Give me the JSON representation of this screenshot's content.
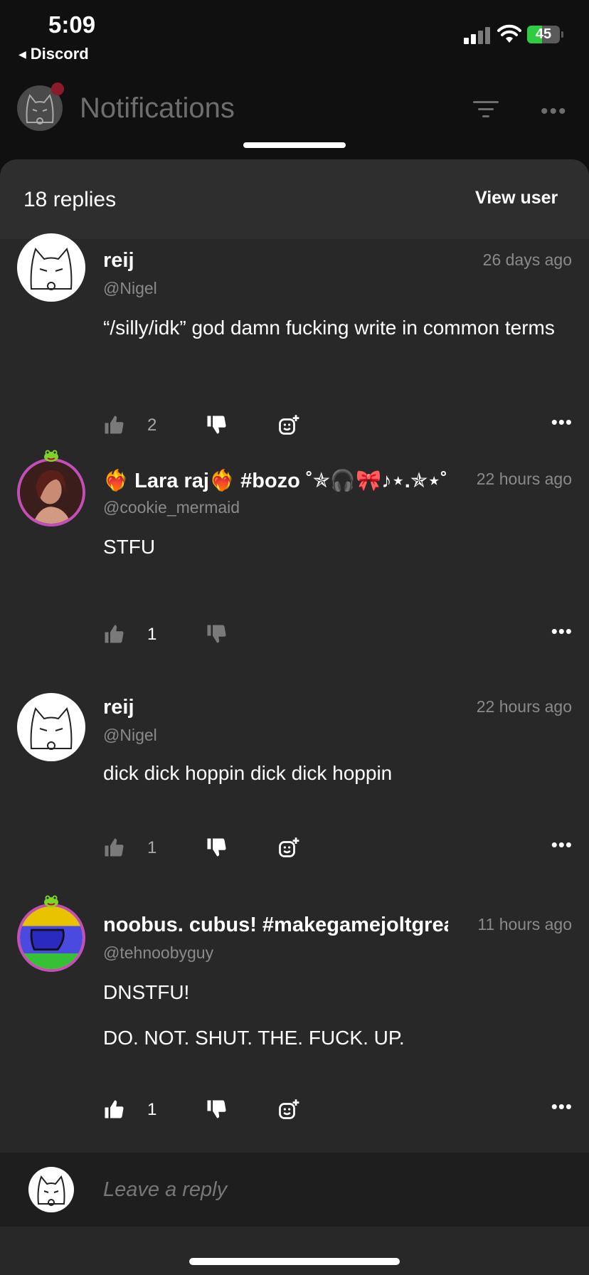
{
  "status_bar": {
    "time": "5:09",
    "back_app": "Discord",
    "battery": "45"
  },
  "header": {
    "title": "Notifications"
  },
  "sheet": {
    "replies_count": "18 replies",
    "view_user_label": "View user"
  },
  "comments": [
    {
      "name": "reij",
      "handle": "@Nigel",
      "time": "26 days ago",
      "body": [
        "“/silly/idk” god damn fucking write in common terms"
      ],
      "likes": "2"
    },
    {
      "name": "❤️‍🔥 Lara raj❤️‍🔥 #bozo ˚✯🎧🎀♪⋆.✯⋆˚✿₊˚",
      "handle": "@cookie_mermaid",
      "time": "22 hours ago",
      "body": [
        "STFU"
      ],
      "likes": "1"
    },
    {
      "name": "reij",
      "handle": "@Nigel",
      "time": "22 hours ago",
      "body": [
        "dick dick hoppin dick dick hoppin"
      ],
      "likes": "1"
    },
    {
      "name": "noobus. cubus! #makegamejoltgreat",
      "handle": "@tehnoobyguy",
      "time": "11 hours ago",
      "body": [
        "DNSTFU!",
        "DO. NOT. SHUT. THE. FUCK. UP."
      ],
      "likes": "1"
    }
  ],
  "reply_bar": {
    "placeholder": "Leave a reply"
  },
  "colors": {
    "background": "#101010",
    "sheet": "#282828",
    "muted_text": "#8a8a8a",
    "avatar_ring": "#c24fb5",
    "battery_green": "#2ecc40",
    "notification_dot": "#8b1a2c"
  }
}
